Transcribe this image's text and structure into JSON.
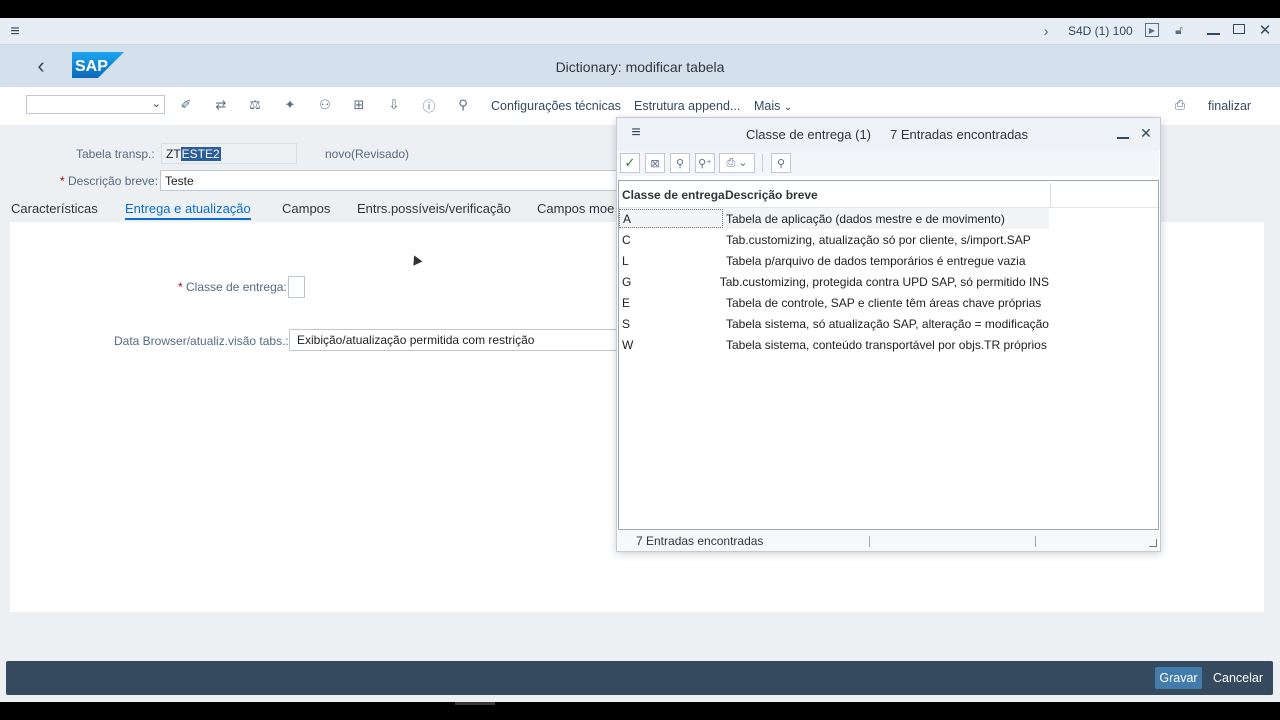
{
  "topbar": {
    "system": "S4D (1) 100"
  },
  "header": {
    "logo": "SAP",
    "title": "Dictionary: modificar tabela"
  },
  "toolbar": {
    "combo_value": "",
    "config_tecnicas": "Configurações técnicas",
    "estrutura_append": "Estrutura append...",
    "mais": "Mais",
    "finalizar": "finalizar"
  },
  "form": {
    "tabela_label": "Tabela transp.:",
    "tabela_prefix": "ZT",
    "tabela_selected": "ESTE2",
    "status": "novo(Revisado)",
    "descricao_label": "Descrição breve:",
    "descricao_value": "Teste",
    "required_mark": "*"
  },
  "tabs": [
    {
      "label": "Características"
    },
    {
      "label": "Entrega e atualização"
    },
    {
      "label": "Campos"
    },
    {
      "label": "Entrs.possíveis/verificação"
    },
    {
      "label": "Campos moe"
    }
  ],
  "panel": {
    "classe_label": "Classe de entrega:",
    "classe_value": "",
    "browser_label": "Data Browser/atualiz.visão tabs.:",
    "browser_value": "Exibição/atualização permitida com restrição"
  },
  "dialog": {
    "title": "Classe de entrega (1)",
    "count": "7 Entradas encontradas",
    "col1": "Classe de entrega",
    "col2": "Descrição breve",
    "rows": [
      {
        "code": "A",
        "desc": "Tabela de aplicação (dados mestre e de movimento)"
      },
      {
        "code": "C",
        "desc": "Tab.customizing, atualização só por cliente, s/import.SAP"
      },
      {
        "code": "L",
        "desc": "Tabela p/arquivo de dados temporários é entregue vazia"
      },
      {
        "code": "G",
        "desc": "Tab.customizing, protegida contra UPD SAP, só permitido INS"
      },
      {
        "code": "E",
        "desc": "Tabela de controle, SAP e cliente têm áreas chave próprias"
      },
      {
        "code": "S",
        "desc": "Tabela sistema, só atualização SAP, alteração = modificação"
      },
      {
        "code": "W",
        "desc": "Tabela sistema, conteúdo transportável por objs.TR próprios"
      }
    ],
    "status": "7 Entradas encontradas"
  },
  "footer": {
    "gravar": "Gravar",
    "cancelar": "Cancelar"
  },
  "colors": {
    "shell": "#d4e0ec",
    "accent": "#0a6ed1",
    "footer": "#354a5f",
    "primary_button": "#427cac"
  }
}
